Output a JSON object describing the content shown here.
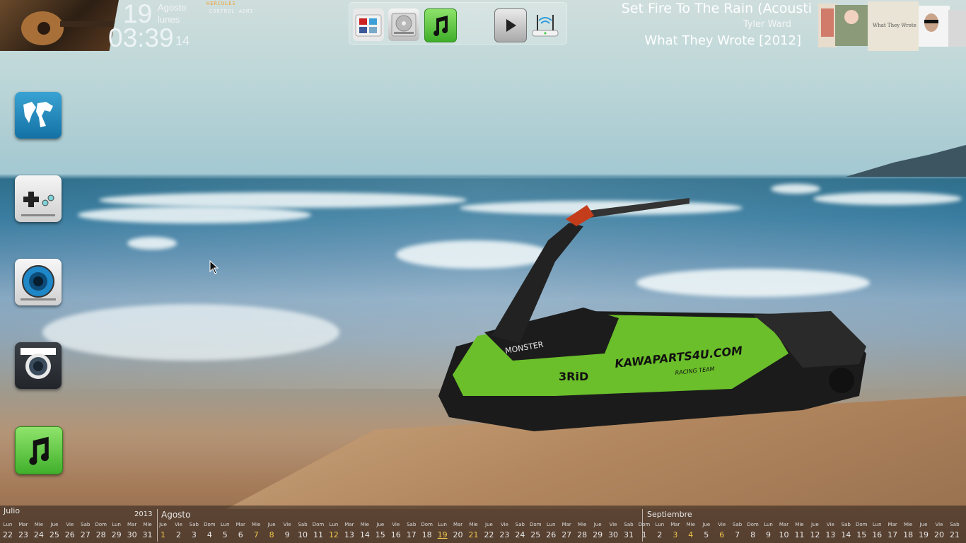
{
  "clock": {
    "day": "19",
    "month": "Agosto",
    "weekday": "lunes",
    "time": "03:39",
    "seconds": "14",
    "links": [
      "HERCULES",
      "CONTROL ADMI"
    ]
  },
  "top_dock": {
    "icons": [
      "social-folder-icon",
      "hard-drive-icon",
      "music-note-icon",
      "play-icon",
      "wifi-router-icon"
    ]
  },
  "now_playing": {
    "title": "Set Fire To The Rain (Acousti",
    "artist": "Tyler Ward",
    "album": "What They Wrote [2012]",
    "album_cover_text": "What They Wrote"
  },
  "left_dock": {
    "icons": [
      "world-map-icon",
      "gamepad-icon",
      "eye-icon",
      "camera-icon",
      "music-note-icon"
    ]
  },
  "calendar": {
    "year": "2013",
    "months": [
      "Julio",
      "Agosto",
      "Septiembre"
    ],
    "weekdays": [
      "Lun",
      "Mar",
      "Mie",
      "Jue",
      "Vie",
      "Sab",
      "Dom"
    ],
    "days": [
      {
        "wd": "Lun",
        "d": "22"
      },
      {
        "wd": "Mar",
        "d": "23"
      },
      {
        "wd": "Mie",
        "d": "24"
      },
      {
        "wd": "Jue",
        "d": "25"
      },
      {
        "wd": "Vie",
        "d": "26"
      },
      {
        "wd": "Sab",
        "d": "27"
      },
      {
        "wd": "Dom",
        "d": "28"
      },
      {
        "wd": "Lun",
        "d": "29"
      },
      {
        "wd": "Mar",
        "d": "30"
      },
      {
        "wd": "Mie",
        "d": "31"
      },
      {
        "wd": "Jue",
        "d": "1"
      },
      {
        "wd": "Vie",
        "d": "2"
      },
      {
        "wd": "Sab",
        "d": "3"
      },
      {
        "wd": "Dom",
        "d": "4"
      },
      {
        "wd": "Lun",
        "d": "5"
      },
      {
        "wd": "Mar",
        "d": "6"
      },
      {
        "wd": "Mie",
        "d": "7"
      },
      {
        "wd": "Jue",
        "d": "8"
      },
      {
        "wd": "Vie",
        "d": "9"
      },
      {
        "wd": "Sab",
        "d": "10"
      },
      {
        "wd": "Dom",
        "d": "11"
      },
      {
        "wd": "Lun",
        "d": "12"
      },
      {
        "wd": "Mar",
        "d": "13"
      },
      {
        "wd": "Mie",
        "d": "14"
      },
      {
        "wd": "Jue",
        "d": "15"
      },
      {
        "wd": "Vie",
        "d": "16"
      },
      {
        "wd": "Sab",
        "d": "17"
      },
      {
        "wd": "Dom",
        "d": "18"
      },
      {
        "wd": "Lun",
        "d": "19"
      },
      {
        "wd": "Mar",
        "d": "20"
      },
      {
        "wd": "Mie",
        "d": "21"
      },
      {
        "wd": "Jue",
        "d": "22"
      },
      {
        "wd": "Vie",
        "d": "23"
      },
      {
        "wd": "Sab",
        "d": "24"
      },
      {
        "wd": "Dom",
        "d": "25"
      },
      {
        "wd": "Lun",
        "d": "26"
      },
      {
        "wd": "Mar",
        "d": "27"
      },
      {
        "wd": "Mie",
        "d": "28"
      },
      {
        "wd": "Jue",
        "d": "29"
      },
      {
        "wd": "Vie",
        "d": "30"
      },
      {
        "wd": "Sab",
        "d": "31"
      },
      {
        "wd": "Dom",
        "d": "1"
      },
      {
        "wd": "Lun",
        "d": "2"
      },
      {
        "wd": "Mar",
        "d": "3"
      },
      {
        "wd": "Mie",
        "d": "4"
      },
      {
        "wd": "Jue",
        "d": "5"
      },
      {
        "wd": "Vie",
        "d": "6"
      },
      {
        "wd": "Sab",
        "d": "7"
      },
      {
        "wd": "Dom",
        "d": "8"
      },
      {
        "wd": "Lun",
        "d": "9"
      },
      {
        "wd": "Mar",
        "d": "10"
      },
      {
        "wd": "Mie",
        "d": "11"
      },
      {
        "wd": "Jue",
        "d": "12"
      },
      {
        "wd": "Vie",
        "d": "13"
      },
      {
        "wd": "Sab",
        "d": "14"
      },
      {
        "wd": "Dom",
        "d": "15"
      },
      {
        "wd": "Lun",
        "d": "16"
      },
      {
        "wd": "Mar",
        "d": "17"
      },
      {
        "wd": "Mie",
        "d": "18"
      },
      {
        "wd": "Jue",
        "d": "19"
      },
      {
        "wd": "Vie",
        "d": "20"
      },
      {
        "wd": "Sab",
        "d": "21"
      }
    ],
    "highlight_days": [
      "1",
      "7",
      "8",
      "12",
      "19",
      "21"
    ],
    "today": "19"
  },
  "wallpaper": {
    "jetski_brand": "MONSTER",
    "jetski_model": "3RiD",
    "jetski_text": "KAWAPARTS4U.COM",
    "jetski_subtext": "RACING TEAM"
  }
}
